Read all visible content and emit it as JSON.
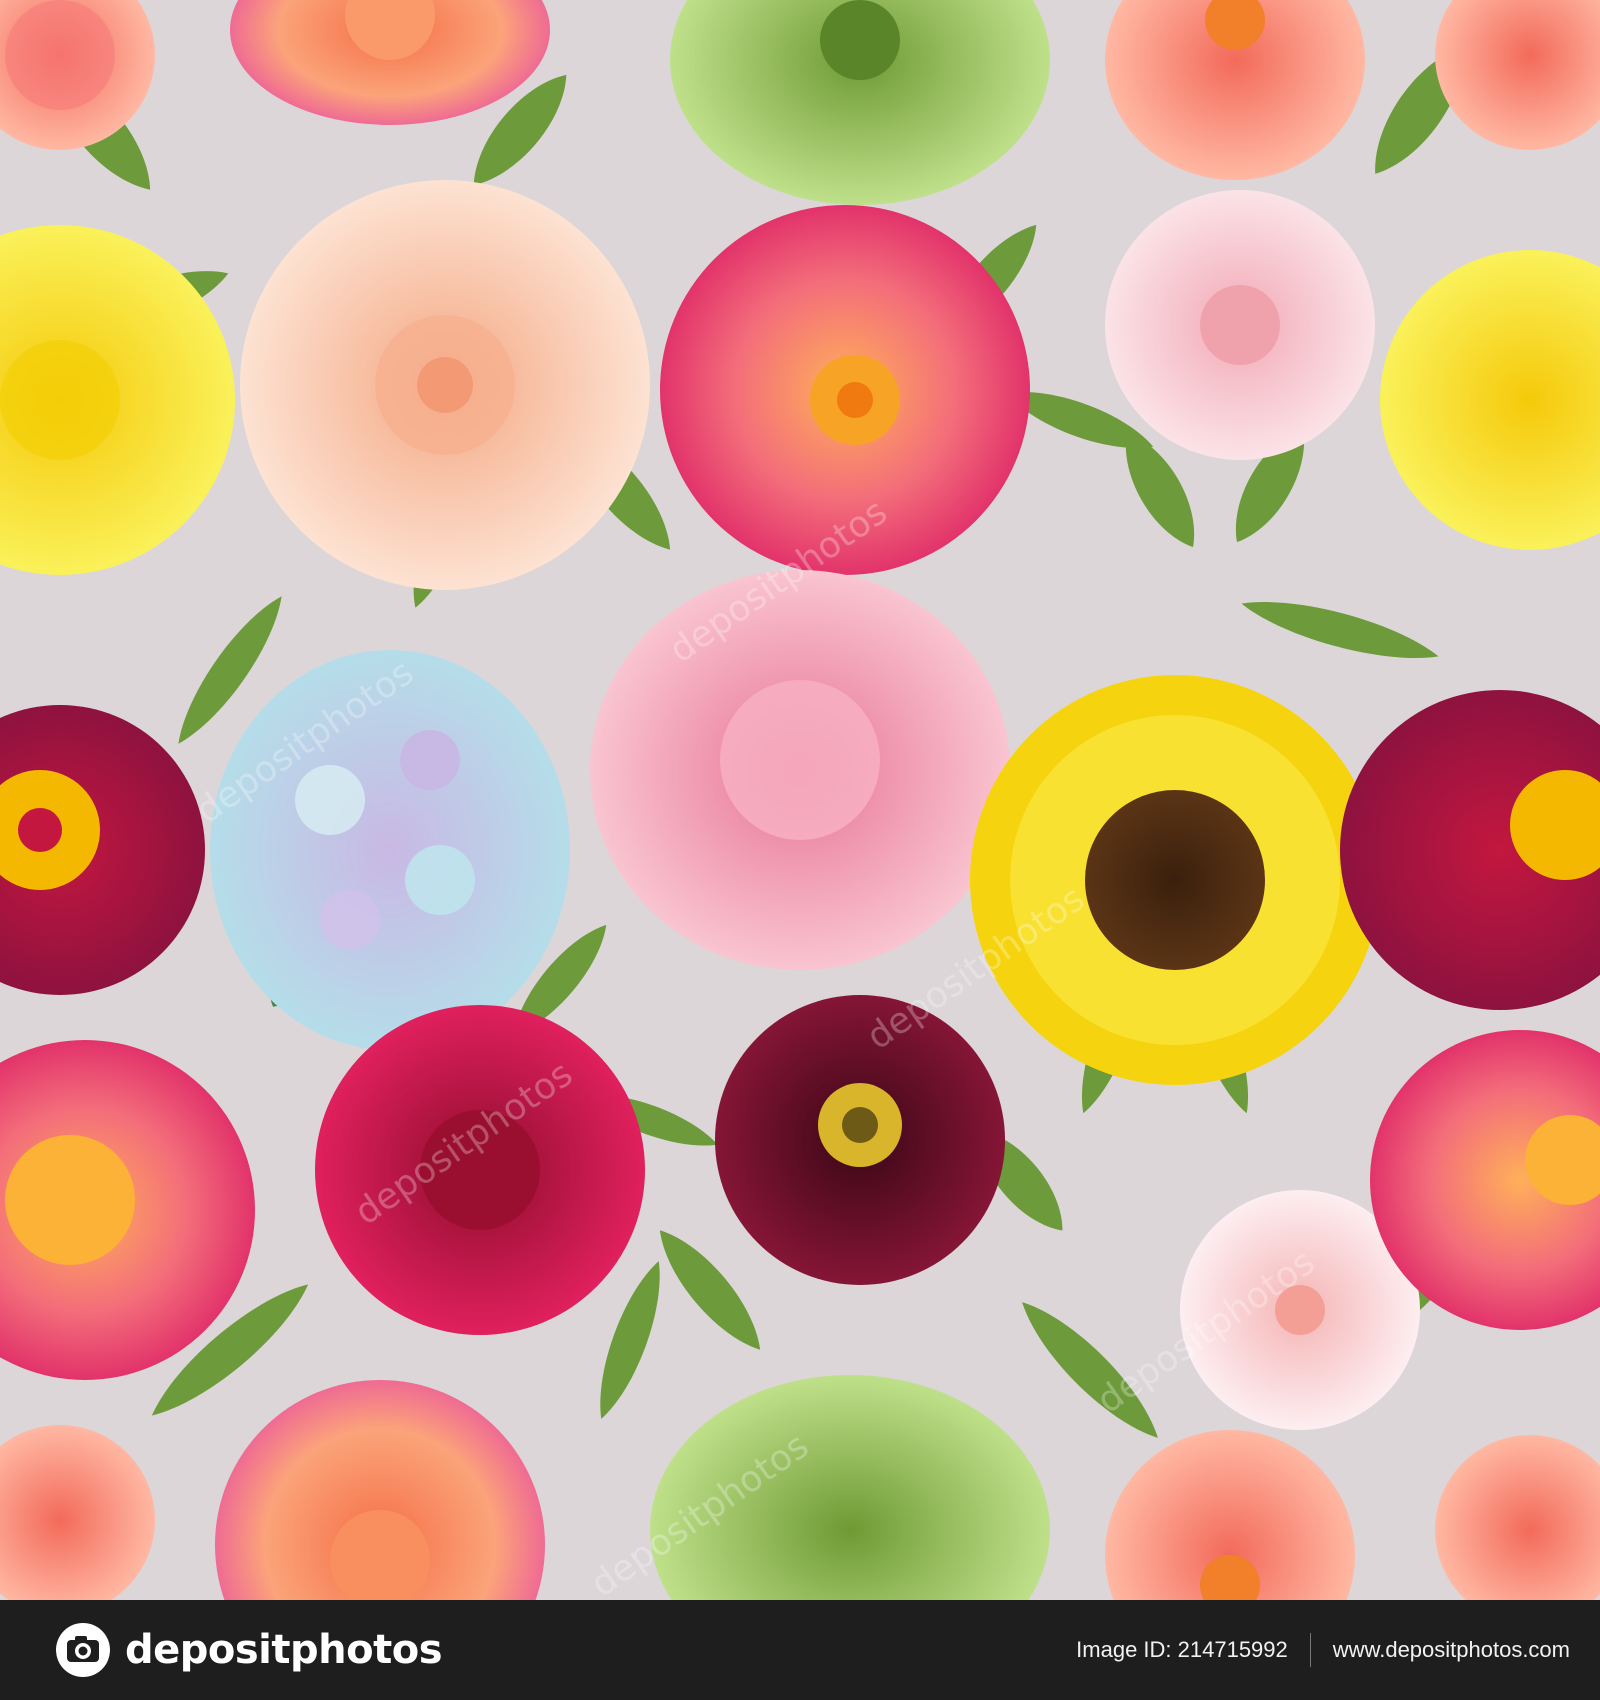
{
  "image": {
    "background_color": "#dcd6d9",
    "subject": "crepe paper flowers seamless pattern",
    "watermark": "depositphotos",
    "flowers": [
      {
        "name": "sunflower",
        "colors": [
          "#f7d916",
          "#4a2a12"
        ]
      },
      {
        "name": "hydrangea",
        "colors": [
          "#b9dbe8",
          "#c6b6e0"
        ]
      },
      {
        "name": "pink-peony",
        "colors": [
          "#f49ab3",
          "#f9c4d0"
        ]
      },
      {
        "name": "peach-dahlia",
        "colors": [
          "#fbd6c2",
          "#f7b796"
        ]
      },
      {
        "name": "coral-peony",
        "colors": [
          "#f36d7a",
          "#fbb37f"
        ]
      },
      {
        "name": "blush-rose",
        "colors": [
          "#f8c9d1",
          "#f2a9b6"
        ]
      },
      {
        "name": "yellow-dahlia",
        "colors": [
          "#f7ee3a",
          "#f5d90f"
        ]
      },
      {
        "name": "burgundy-peony",
        "colors": [
          "#a3164a",
          "#f5b800"
        ]
      },
      {
        "name": "magenta-rose",
        "colors": [
          "#d91a55",
          "#a50f33"
        ]
      },
      {
        "name": "burgundy-poppy",
        "colors": [
          "#6d0f2a",
          "#d9b52b"
        ]
      },
      {
        "name": "pale-pink-dahlia",
        "colors": [
          "#fbe0e6",
          "#f6c2cc"
        ]
      },
      {
        "name": "green-chrysanthemum",
        "colors": [
          "#a8cf6b",
          "#86b14c"
        ]
      },
      {
        "name": "orange-rose",
        "colors": [
          "#f89b6a",
          "#f26f8a"
        ]
      },
      {
        "name": "salmon-camellia",
        "colors": [
          "#f8917f",
          "#ffb29a"
        ]
      }
    ],
    "leaf_color": "#6d9a3a"
  },
  "footer": {
    "brand": "depositphotos",
    "image_id_label": "Image ID: 214715992",
    "site_url": "www.depositphotos.com"
  }
}
